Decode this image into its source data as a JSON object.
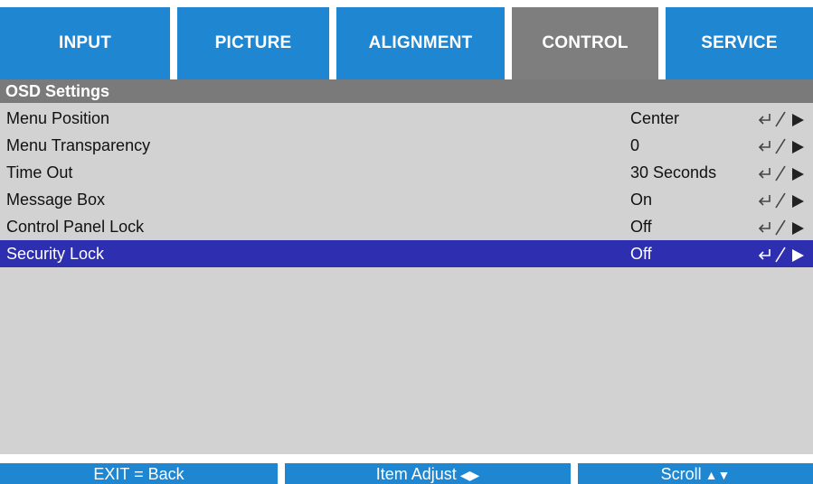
{
  "tabs": [
    {
      "label": "INPUT",
      "active": false
    },
    {
      "label": "PICTURE",
      "active": false
    },
    {
      "label": "ALIGNMENT",
      "active": false
    },
    {
      "label": "CONTROL",
      "active": true
    },
    {
      "label": "SERVICE",
      "active": false
    }
  ],
  "section": {
    "title": "OSD Settings"
  },
  "items": [
    {
      "label": "Menu Position",
      "value": "Center",
      "adjust_icon": "enter-or-right-arrow-icon"
    },
    {
      "label": "Menu Transparency",
      "value": "0",
      "adjust_icon": "enter-or-right-arrow-icon"
    },
    {
      "label": "Time Out",
      "value": "30 Seconds",
      "adjust_icon": "enter-or-right-arrow-icon"
    },
    {
      "label": "Message Box",
      "value": "On",
      "adjust_icon": "enter-or-right-arrow-icon"
    },
    {
      "label": "Control Panel Lock",
      "value": "Off",
      "adjust_icon": "enter-or-right-arrow-icon"
    },
    {
      "label": "Security Lock",
      "value": "Off",
      "adjust_icon": "enter-or-right-arrow-icon",
      "selected": true
    }
  ],
  "footer": {
    "exit_label": "EXIT = Back",
    "adjust_label": "Item Adjust",
    "adjust_symbol": "◀▶",
    "scroll_label": "Scroll",
    "scroll_symbol": "▲▼"
  },
  "colors": {
    "tab_blue": "#1f86d2",
    "tab_active_gray": "#7e7e7e",
    "header_gray": "#7a7a7a",
    "content_bg": "#d2d2d2",
    "selected_row": "#2e2fb0"
  }
}
